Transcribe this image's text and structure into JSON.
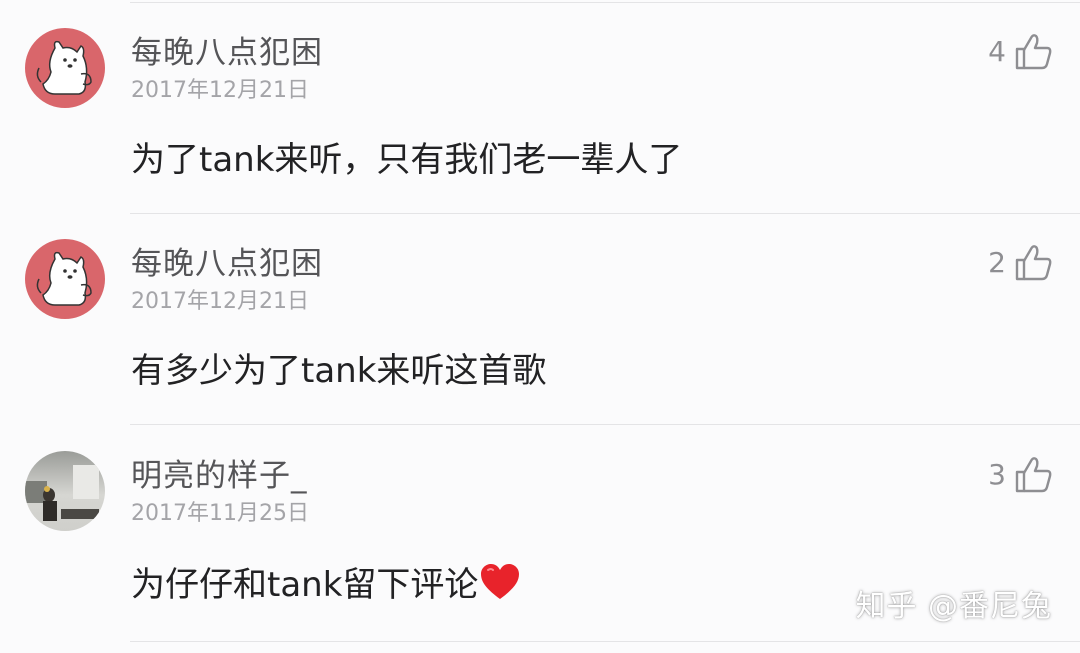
{
  "colors": {
    "background": "#fbfbfc",
    "divider": "#e4e4e6",
    "username": "#555558",
    "date": "#a4a4a8",
    "content": "#222224",
    "like": "#8e8e92",
    "avatar_bg": "#d9666b",
    "heart": "#e8232b"
  },
  "comments": [
    {
      "username": "每晚八点犯困",
      "date": "2017年12月21日",
      "likes": "4",
      "content": "为了tank来听，只有我们老一辈人了",
      "avatar_icon": "cartoon-dog-avatar",
      "like_icon": "thumbs-up-icon"
    },
    {
      "username": "每晚八点犯困",
      "date": "2017年12月21日",
      "likes": "2",
      "content": "有多少为了tank来听这首歌",
      "avatar_icon": "cartoon-dog-avatar",
      "like_icon": "thumbs-up-icon"
    },
    {
      "username": "明亮的样子_",
      "date": "2017年11月25日",
      "likes": "3",
      "content": "为仔仔和tank留下评论",
      "content_suffix_icon": "red-heart-icon",
      "avatar_icon": "photo-avatar",
      "like_icon": "thumbs-up-icon"
    }
  ],
  "watermark": "知乎 @番尼兔"
}
